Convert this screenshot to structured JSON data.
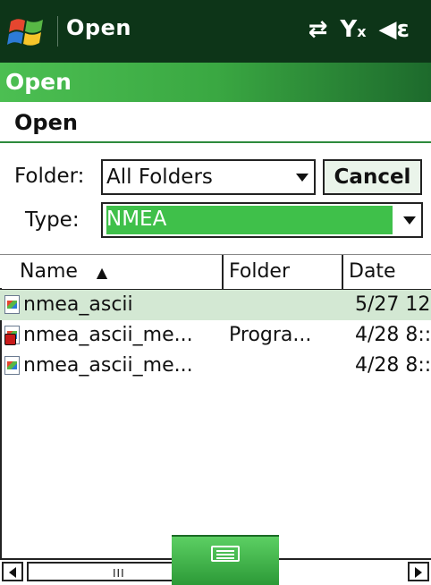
{
  "status_bar": {
    "title": "Open",
    "start_icon": "windows-flag-icon",
    "icons": [
      "connectivity-icon",
      "signal-off-icon",
      "speaker-muted-icon"
    ],
    "colors": {
      "background": "#0d3518",
      "text": "#ffffff"
    }
  },
  "title_bar": {
    "title": "Open",
    "colors": {
      "accent": "#3aa842"
    }
  },
  "header": {
    "title": "Open"
  },
  "form": {
    "folder_label": "Folder:",
    "folder_value": "All Folders",
    "cancel_label": "Cancel",
    "type_label": "Type:",
    "type_value": "NMEA"
  },
  "table": {
    "columns": [
      {
        "label": "Name",
        "sort": "ascending"
      },
      {
        "label": "Folder"
      },
      {
        "label": "Date"
      }
    ],
    "rows": [
      {
        "name": "nmea_ascii",
        "folder": "",
        "date": "5/27 12",
        "selected": true,
        "icon": "document-icon"
      },
      {
        "name": "nmea_ascii_me...",
        "folder": "Progra...",
        "date": "4/28 8::",
        "selected": false,
        "icon": "document-shortcut-icon"
      },
      {
        "name": "nmea_ascii_me...",
        "folder": "",
        "date": "4/28 8::",
        "selected": false,
        "icon": "document-icon"
      }
    ]
  },
  "scrollbar": {
    "grip": "III"
  },
  "keyboard": {
    "icon": "keyboard-icon"
  }
}
